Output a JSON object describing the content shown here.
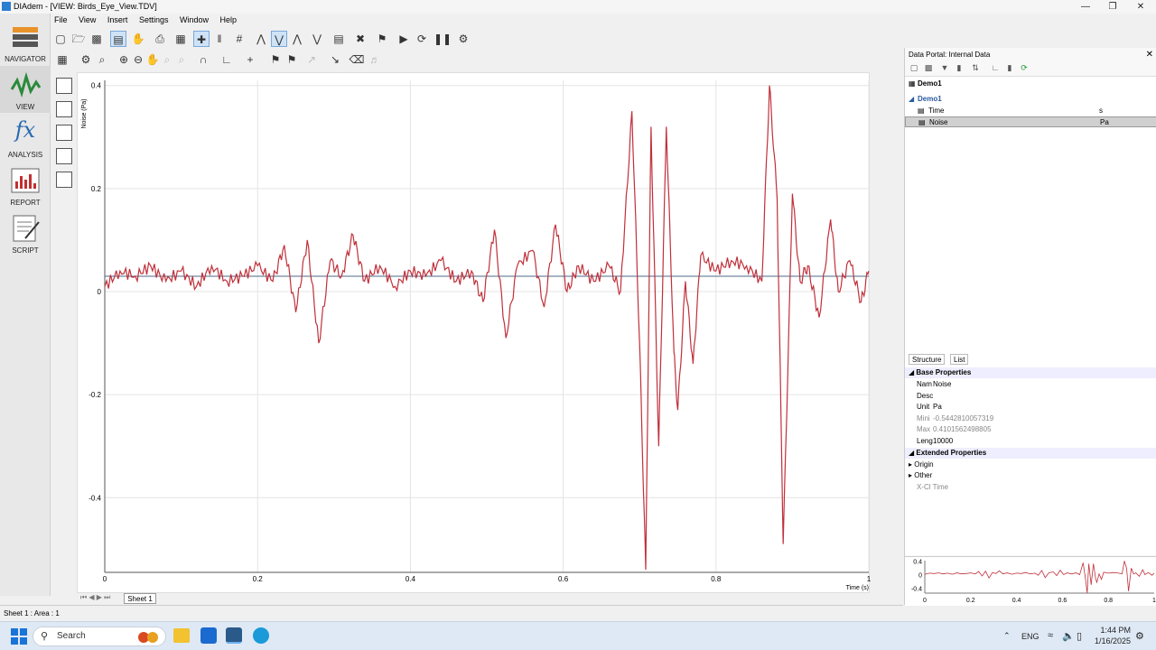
{
  "window": {
    "title": "DIAdem - [VIEW:  Birds_Eye_View.TDV]"
  },
  "menu": [
    "File",
    "View",
    "Insert",
    "Settings",
    "Window",
    "Help"
  ],
  "nav": [
    {
      "label": "NAVIGATOR"
    },
    {
      "label": "VIEW"
    },
    {
      "label": "ANALYSIS"
    },
    {
      "label": "REPORT"
    },
    {
      "label": "SCRIPT"
    }
  ],
  "chart": {
    "ylabel": "Noise (Pa)",
    "xlabel": "Time (s)",
    "yticks": [
      "0.4",
      "0.2",
      "0",
      "-0.2",
      "-0.4"
    ],
    "xticks": [
      "0",
      "0.2",
      "0.4",
      "0.6",
      "0.8",
      "1"
    ],
    "line_color": "#c0303a"
  },
  "chart_data": {
    "type": "line",
    "x_range": [
      0,
      1
    ],
    "ylim": [
      -0.545,
      0.41
    ],
    "xlabel": "Time (s)",
    "ylabel": "Noise (Pa)",
    "grid": true,
    "series": [
      {
        "name": "Noise",
        "points": [
          [
            0,
            0.01
          ],
          [
            0.02,
            0.04
          ],
          [
            0.04,
            0.03
          ],
          [
            0.06,
            0.05
          ],
          [
            0.08,
            0.02
          ],
          [
            0.1,
            0.04
          ],
          [
            0.12,
            0.01
          ],
          [
            0.14,
            0.05
          ],
          [
            0.16,
            0.02
          ],
          [
            0.18,
            0.03
          ],
          [
            0.2,
            0.05
          ],
          [
            0.22,
            0.02
          ],
          [
            0.235,
            0.09
          ],
          [
            0.25,
            -0.04
          ],
          [
            0.265,
            0.1
          ],
          [
            0.28,
            -0.1
          ],
          [
            0.295,
            0.06
          ],
          [
            0.31,
            0.03
          ],
          [
            0.325,
            0.11
          ],
          [
            0.34,
            0.02
          ],
          [
            0.36,
            0.05
          ],
          [
            0.38,
            0.01
          ],
          [
            0.4,
            0.04
          ],
          [
            0.42,
            0.03
          ],
          [
            0.44,
            0.06
          ],
          [
            0.46,
            0.02
          ],
          [
            0.48,
            0.04
          ],
          [
            0.495,
            -0.02
          ],
          [
            0.51,
            0.12
          ],
          [
            0.525,
            -0.09
          ],
          [
            0.54,
            0.05
          ],
          [
            0.56,
            0.08
          ],
          [
            0.575,
            -0.03
          ],
          [
            0.59,
            0.13
          ],
          [
            0.605,
            0.0
          ],
          [
            0.62,
            0.05
          ],
          [
            0.64,
            0.02
          ],
          [
            0.66,
            0.05
          ],
          [
            0.675,
            0.0
          ],
          [
            0.69,
            0.35
          ],
          [
            0.7,
            -0.1
          ],
          [
            0.708,
            -0.54
          ],
          [
            0.715,
            0.32
          ],
          [
            0.725,
            -0.3
          ],
          [
            0.735,
            0.32
          ],
          [
            0.745,
            -0.12
          ],
          [
            0.75,
            -0.23
          ],
          [
            0.76,
            0.02
          ],
          [
            0.77,
            -0.14
          ],
          [
            0.78,
            0.07
          ],
          [
            0.8,
            0.04
          ],
          [
            0.82,
            0.06
          ],
          [
            0.84,
            0.05
          ],
          [
            0.86,
            0.02
          ],
          [
            0.87,
            0.4
          ],
          [
            0.88,
            0.18
          ],
          [
            0.888,
            -0.49
          ],
          [
            0.9,
            0.19
          ],
          [
            0.91,
            0.02
          ],
          [
            0.92,
            0.05
          ],
          [
            0.935,
            -0.05
          ],
          [
            0.95,
            0.14
          ],
          [
            0.96,
            0.0
          ],
          [
            0.975,
            0.06
          ],
          [
            0.99,
            -0.02
          ],
          [
            1,
            0.04
          ]
        ]
      }
    ]
  },
  "sheet": {
    "tab": "Sheet 1"
  },
  "status": {
    "text": "Sheet 1 : Area : 1"
  },
  "portal": {
    "title": "Data Portal: Internal Data",
    "root": "Demo1",
    "group": "Demo1",
    "channels": [
      {
        "name": "Time",
        "unit": "s",
        "selected": false
      },
      {
        "name": "Noise",
        "unit": "Pa",
        "selected": true
      }
    ],
    "tabs": [
      "Structure",
      "List"
    ],
    "props": {
      "base_title": "Base Properties",
      "rows": [
        {
          "k": "Nam",
          "v": "Noise",
          "dim": false
        },
        {
          "k": "Desc",
          "v": "",
          "dim": false
        },
        {
          "k": "Unit",
          "v": "Pa",
          "dim": false
        },
        {
          "k": "Mini",
          "v": "-0.5442810057319",
          "dim": true
        },
        {
          "k": "Max",
          "v": "0.4101562498805",
          "dim": true
        },
        {
          "k": "Leng",
          "v": "10000",
          "dim": false
        }
      ],
      "ext_title": "Extended Properties",
      "ext": [
        "Origin",
        "Other"
      ],
      "xch": "X-Cl Time"
    },
    "preview": {
      "yticks": [
        "0.4",
        "0",
        "-0.4"
      ],
      "xticks": [
        "0",
        "0.2",
        "0.4",
        "0.6",
        "0.8",
        "1"
      ]
    }
  },
  "taskbar": {
    "search": "Search",
    "lang": "ENG",
    "time": "1:44 PM",
    "date": "1/16/2025"
  }
}
